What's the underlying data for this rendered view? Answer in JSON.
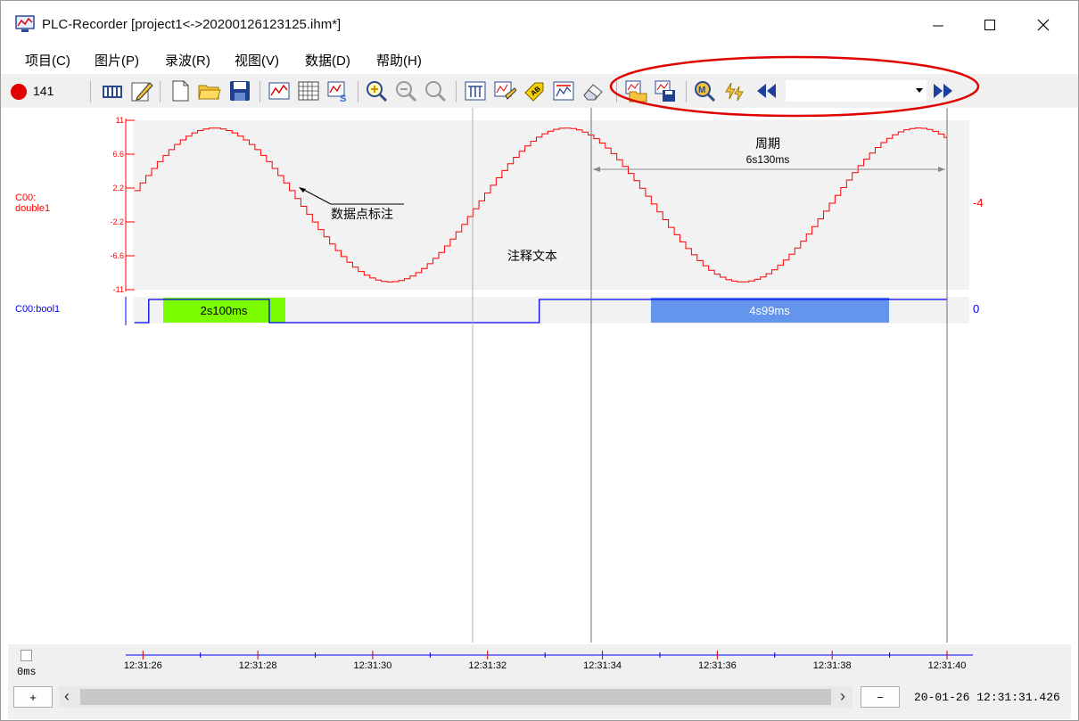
{
  "window": {
    "title": "PLC-Recorder  [project1<->20200126123125.ihm*]",
    "minimize_glyph": "—",
    "maximize_glyph": "☐",
    "close_glyph": "✕"
  },
  "menu": [
    {
      "label": "项目(C)"
    },
    {
      "label": "图片(P)"
    },
    {
      "label": "录波(R)"
    },
    {
      "label": "视图(V)"
    },
    {
      "label": "数据(D)"
    },
    {
      "label": "帮助(H)"
    }
  ],
  "toolbar": {
    "record_count": "141",
    "record_color": "#e00000",
    "icons": [
      "plc-icon",
      "edit-icon",
      "new-file-icon",
      "open-folder-icon",
      "save-icon",
      "trend-icon",
      "grid-icon",
      "signal-settings-icon",
      "zoom-in-icon",
      "zoom-out-icon",
      "zoom-reset-icon",
      "marker-icon",
      "annotate-icon",
      "label-icon",
      "chart-icon",
      "eraser-icon",
      "open-record-icon",
      "save-record-icon",
      "search-marker-icon",
      "auto-icon",
      "rewind-icon",
      "fast-forward-icon"
    ],
    "combo_value": "",
    "highlight_color": "#e00000"
  },
  "chart": {
    "channels": [
      {
        "name": "C00:\ndouble1",
        "color": "#ff0000",
        "current_value": "-4"
      },
      {
        "name": "C00:bool1",
        "color": "#0000ff",
        "current_value": "0"
      }
    ],
    "y_ticks": [
      "11",
      "6.6",
      "2.2",
      "-2.2",
      "-6.6",
      "-11"
    ],
    "annotations": {
      "point_label": "数据点标注",
      "note_text": "注释文本",
      "period_label": "周期",
      "period_value": "6s130ms",
      "span1": "2s100ms",
      "span2": "4s99ms"
    },
    "span1_color": "#7cfc00",
    "span2_color": "#6495ed"
  },
  "chart_data": {
    "type": "line",
    "title": "",
    "xlabel": "",
    "ylabel": "",
    "x_ticks": [
      "12:31:26",
      "12:31:28",
      "12:31:30",
      "12:31:32",
      "12:31:34",
      "12:31:36",
      "12:31:38",
      "12:31:40"
    ],
    "xlim": [
      "12:31:25.7",
      "12:31:40.0"
    ],
    "ylim": [
      -11,
      11
    ],
    "grid": false,
    "series": [
      {
        "name": "C00:double1",
        "type": "stepped-sine",
        "amplitude": 10,
        "period_s": 6.13,
        "peaks_at": [
          "12:31:27.2",
          "12:31:33.4",
          "12:31:39.5"
        ]
      },
      {
        "name": "C00:bool1",
        "type": "digital",
        "high_intervals": [
          [
            "12:31:26.1",
            "12:31:28.2"
          ],
          [
            "12:31:32.9",
            "12:31:40.0"
          ]
        ]
      }
    ]
  },
  "bottom": {
    "offset_label": "0ms",
    "plus_label": "+",
    "minus_label": "−",
    "left_arrow": "‹",
    "right_arrow": "›",
    "timestamp": "20-01-26 12:31:31.426"
  }
}
